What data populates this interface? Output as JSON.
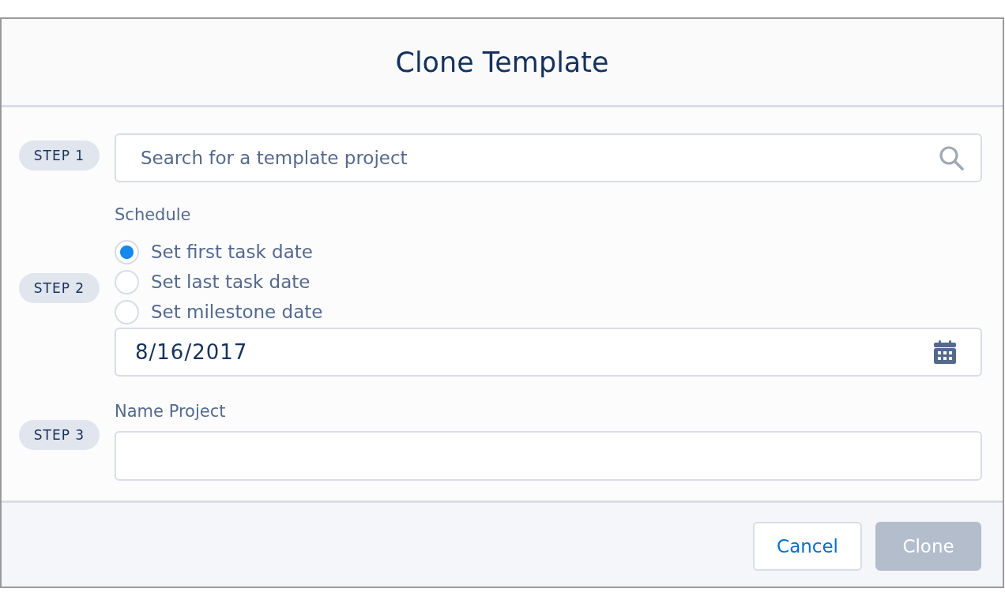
{
  "dialog": {
    "title": "Clone Template"
  },
  "steps": [
    {
      "badge": "STEP 1",
      "kind": "search",
      "placeholder": "Search for a template project"
    },
    {
      "badge": "STEP 2",
      "kind": "schedule",
      "label": "Schedule",
      "options": [
        {
          "label": "Set first task date",
          "selected": true
        },
        {
          "label": "Set last task date",
          "selected": false
        },
        {
          "label": "Set milestone date",
          "selected": false
        }
      ],
      "date_value": "8/16/2017"
    },
    {
      "badge": "STEP 3",
      "kind": "text",
      "label": "Name Project"
    }
  ],
  "buttons": [
    {
      "label": "Cancel",
      "disabled": false
    },
    {
      "label": "Clone",
      "disabled": true
    }
  ]
}
